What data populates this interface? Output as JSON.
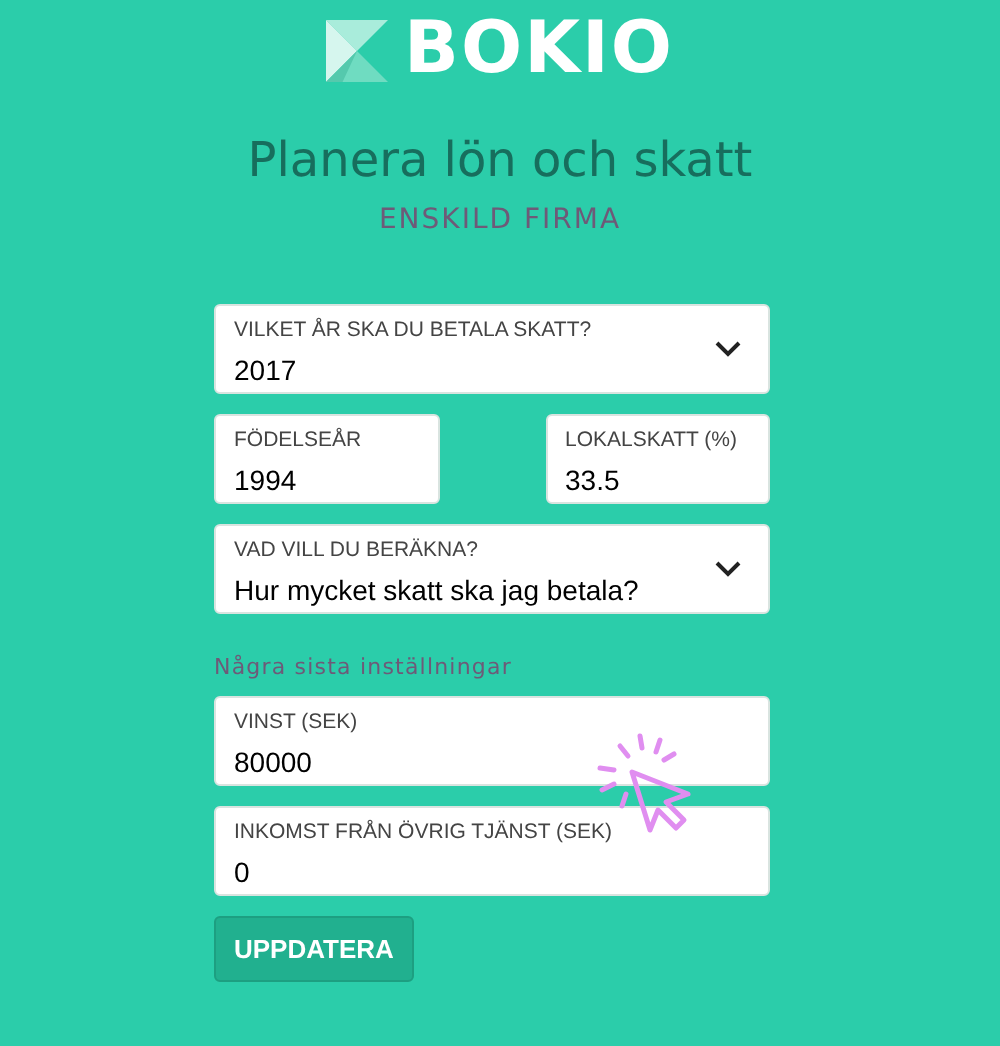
{
  "logo": {
    "text": "BOKIO"
  },
  "title": "Planera lön och skatt",
  "subtitle": "ENSKILD FIRMA",
  "field_rows": [
    {
      "fields": [
        {
          "kind": "select",
          "label": "VILKET ÅR SKA DU BETALA SKATT?",
          "value": "2017"
        }
      ]
    },
    {
      "fields": [
        {
          "kind": "input",
          "label": "FÖDELSEÅR",
          "value": "1994"
        },
        {
          "kind": "input",
          "label": "LOKALSKATT (%)",
          "value": "33.5"
        }
      ]
    },
    {
      "fields": [
        {
          "kind": "select",
          "label": "VAD VILL DU BERÄKNA?",
          "value": "Hur mycket skatt ska jag betala?"
        }
      ]
    }
  ],
  "section_label": "Några sista inställningar",
  "more_fields": [
    {
      "label": "VINST (SEK)",
      "value": "80000"
    },
    {
      "label": "INKOMST FRÅN ÖVRIG TJÄNST (SEK)",
      "value": "0"
    }
  ],
  "button": "UPPDATERA"
}
